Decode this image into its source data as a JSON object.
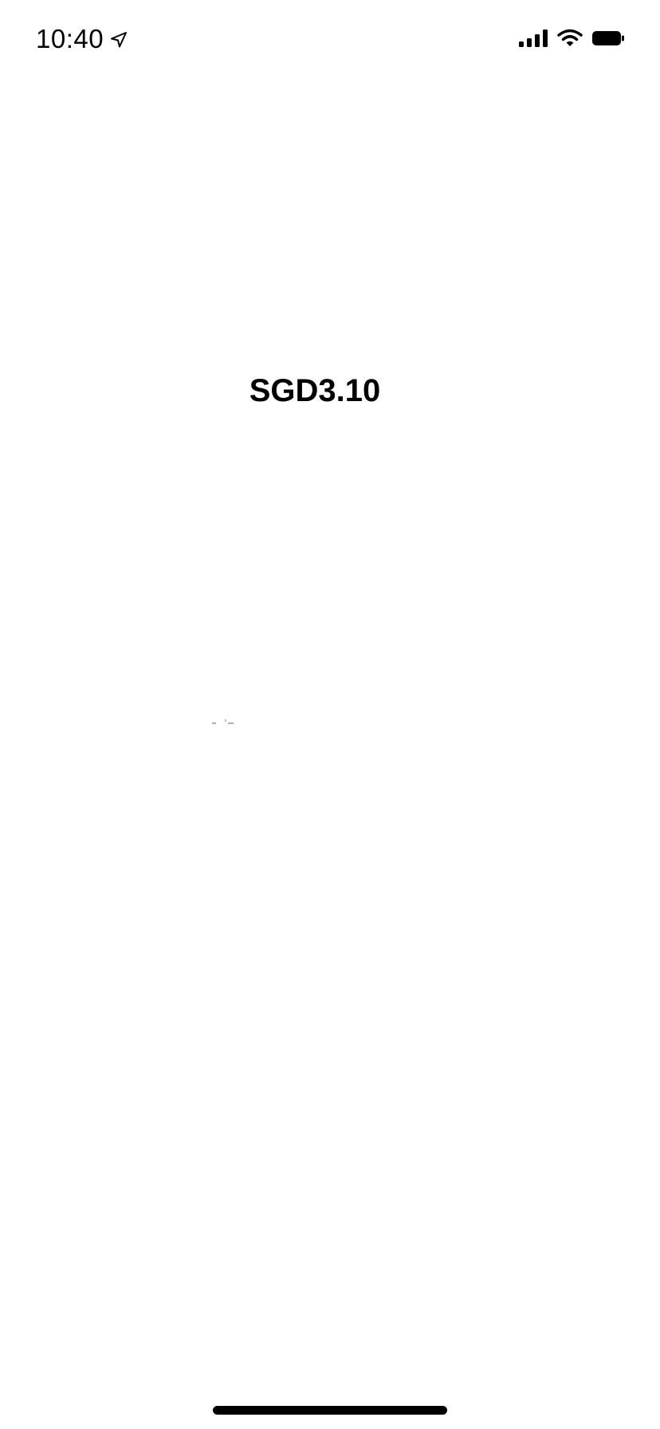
{
  "status_bar": {
    "time": "10:40",
    "location_icon": "location-arrow-icon",
    "signal_icon": "cellular-signal-icon",
    "wifi_icon": "wifi-icon",
    "battery_icon": "battery-icon"
  },
  "main": {
    "price": "SGD3.10"
  },
  "colors": {
    "background": "#ffffff",
    "text": "#000000"
  }
}
